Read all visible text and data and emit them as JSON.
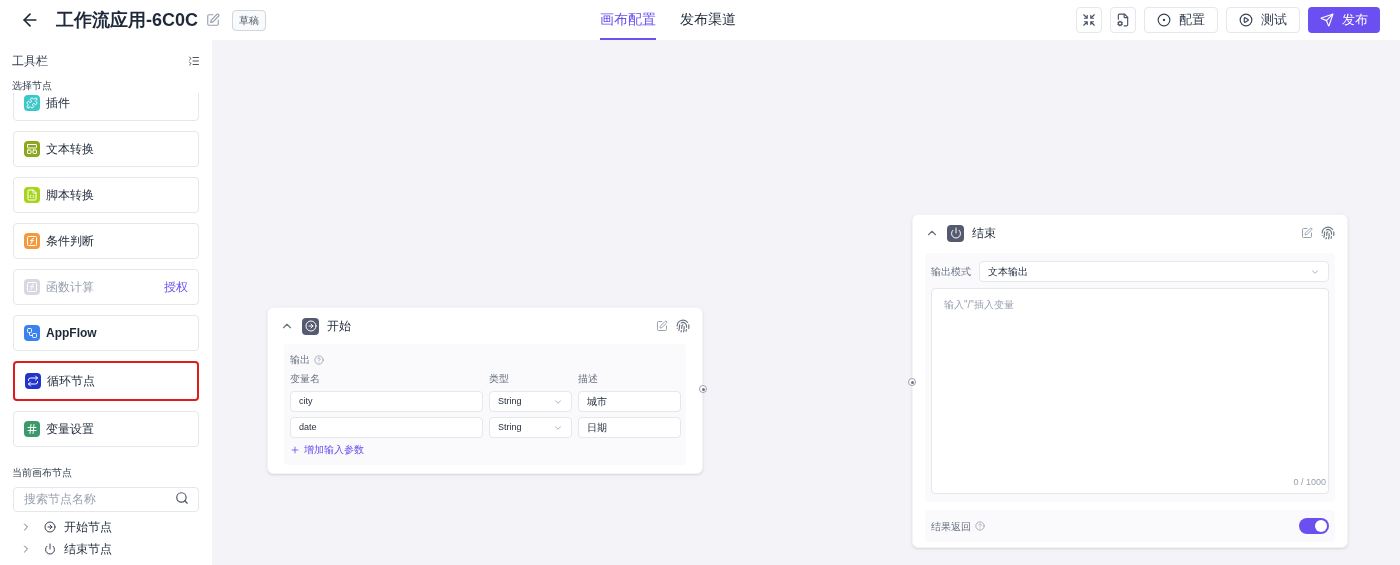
{
  "header": {
    "title": "工作流应用-6C0C",
    "badge": "草稿",
    "tabs": [
      {
        "label": "画布配置",
        "selected": true
      },
      {
        "label": "发布渠道",
        "selected": false
      }
    ],
    "buttons": [
      {
        "kind": "icon"
      },
      {
        "kind": "icon"
      },
      {
        "kind": "default",
        "label": "配置"
      },
      {
        "kind": "default",
        "label": "测试"
      },
      {
        "kind": "primary",
        "label": "发布"
      }
    ]
  },
  "sidebar": {
    "title": "工具栏",
    "section": "选择节点",
    "tools": [
      {
        "label": "插件",
        "kind": "plugin",
        "color": "#3cc8c8",
        "disabled": false,
        "highlighted": false
      },
      {
        "label": "文本转换",
        "kind": "text",
        "color": "#8aa81e",
        "disabled": false,
        "highlighted": false
      },
      {
        "label": "脚本转换",
        "kind": "script",
        "color": "#a8d41e",
        "disabled": false,
        "highlighted": false
      },
      {
        "label": "条件判断",
        "kind": "if",
        "color": "#f59a3c",
        "disabled": false,
        "highlighted": false
      },
      {
        "label": "函数计算",
        "kind": "fx",
        "color": "#d8d8e0",
        "disabled": true,
        "highlighted": false,
        "action": "授权"
      },
      {
        "label": "AppFlow",
        "kind": "flow",
        "color": "#3a82f0",
        "disabled": false,
        "highlighted": false
      },
      {
        "label": "循环节点",
        "kind": "loop",
        "color": "#2233cc",
        "disabled": false,
        "highlighted": true
      },
      {
        "label": "变量设置",
        "kind": "var",
        "color": "#3a9a6a",
        "disabled": false,
        "highlighted": false
      }
    ],
    "canvas_section": "当前画布节点",
    "search": {
      "placeholder": "搜索节点名称"
    },
    "tree": [
      {
        "label": "开始节点",
        "kind": "start",
        "expanded": false
      },
      {
        "label": "结束节点",
        "kind": "end",
        "expanded": false
      }
    ]
  },
  "start_node": {
    "title": "开始",
    "expanded": true,
    "output_label": "输出",
    "columns": [
      "变量名",
      "类型",
      "描述"
    ],
    "rows": [
      {
        "name": "city",
        "type": "String",
        "desc": "城市"
      },
      {
        "name": "date",
        "type": "String",
        "desc": "日期"
      }
    ],
    "add": "增加输入参数"
  },
  "end_node": {
    "title": "结束",
    "expanded": true,
    "mode_label": "输出模式",
    "mode": "文本输出",
    "placeholder": "输入\"/\"插入变量",
    "counter": "0 / 1000",
    "return_label": "结果返回",
    "return_on": true
  }
}
